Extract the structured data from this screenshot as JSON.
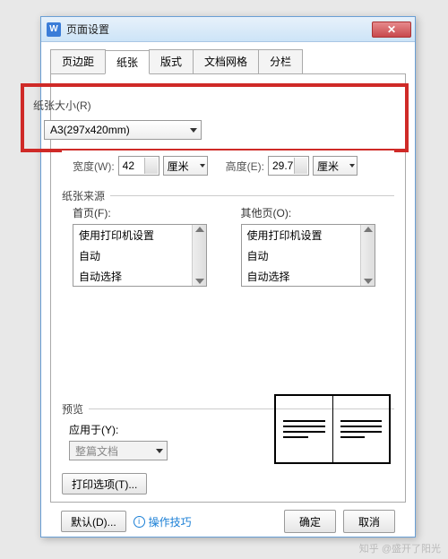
{
  "title": "页面设置",
  "tabs": [
    "页边距",
    "纸张",
    "版式",
    "文档网格",
    "分栏"
  ],
  "active_tab": 1,
  "paper_size": {
    "label": "纸张大小(R)",
    "value": "A3(297x420mm)"
  },
  "width": {
    "label": "宽度(W):",
    "value": "42",
    "unit": "厘米"
  },
  "height": {
    "label": "高度(E):",
    "value": "29.7",
    "unit": "厘米"
  },
  "paper_source": {
    "label": "纸张来源",
    "first_page": {
      "label": "首页(F):",
      "items": [
        "使用打印机设置",
        "自动",
        "自动选择"
      ]
    },
    "other_pages": {
      "label": "其他页(O):",
      "items": [
        "使用打印机设置",
        "自动",
        "自动选择"
      ]
    }
  },
  "preview": {
    "label": "预览",
    "apply_label": "应用于(Y):",
    "apply_value": "整篇文档"
  },
  "print_options_label": "打印选项(T)...",
  "footer": {
    "default": "默认(D)...",
    "tips": "操作技巧",
    "ok": "确定",
    "cancel": "取消"
  },
  "watermark": "知乎 @盛开了阳光"
}
